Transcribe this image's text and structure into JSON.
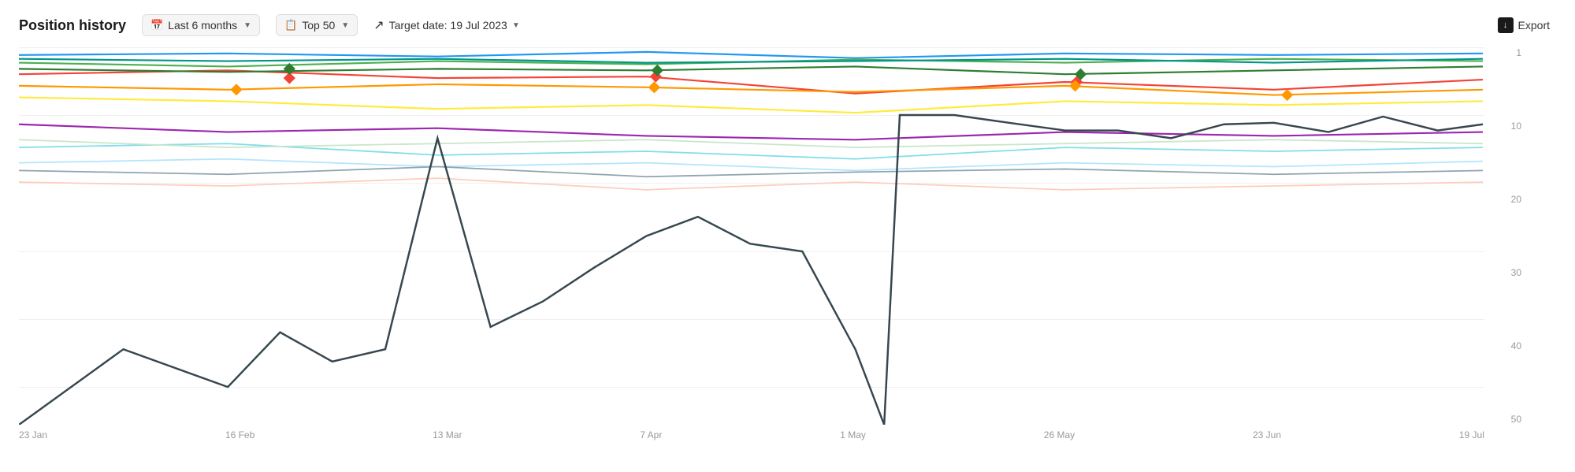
{
  "header": {
    "title": "Position history",
    "period_label": "Last 6 months",
    "top_label": "Top 50",
    "target_label": "Target date: 19 Jul 2023",
    "export_label": "Export"
  },
  "chart": {
    "y_labels": [
      "1",
      "10",
      "20",
      "30",
      "40",
      "50"
    ],
    "x_labels": [
      "23 Jan",
      "16 Feb",
      "13 Mar",
      "7 Apr",
      "1 May",
      "26 May",
      "23 Jun",
      "19 Jul"
    ]
  }
}
